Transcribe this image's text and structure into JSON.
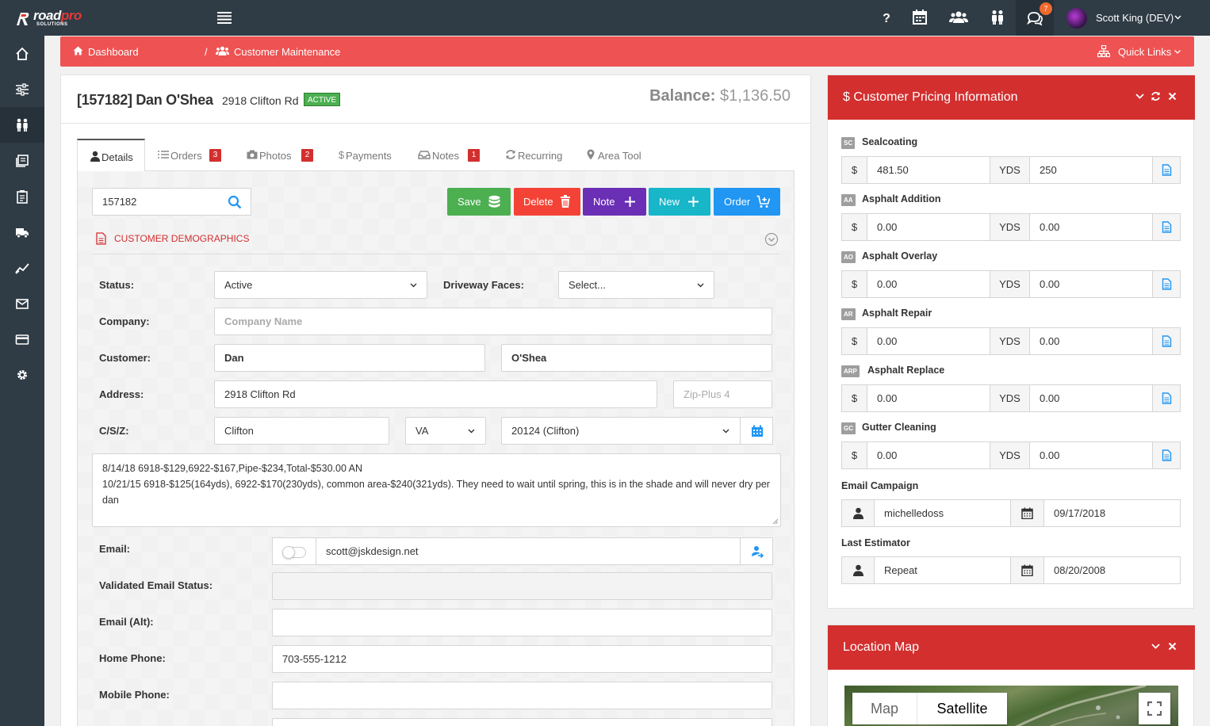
{
  "topbar": {
    "logo_word": "road",
    "logo_word_accent": "pro",
    "logo_sub": "SOLUTIONS",
    "notification_count": "7",
    "user_name": "Scott King (DEV)"
  },
  "breadcrumb": {
    "home": "Dashboard",
    "separator": "/",
    "current": "Customer Maintenance",
    "quick_links": "Quick Links"
  },
  "customer": {
    "title": "[157182] Dan O'Shea",
    "address": "2918 Clifton Rd",
    "status_badge": "ACTIVE",
    "balance_label": "Balance:",
    "balance_value": "$1,136.50"
  },
  "tabs": [
    {
      "label": "Details",
      "badge": ""
    },
    {
      "label": "Orders",
      "badge": "3"
    },
    {
      "label": "Photos",
      "badge": "2"
    },
    {
      "label": "Payments",
      "badge": ""
    },
    {
      "label": "Notes",
      "badge": "1"
    },
    {
      "label": "Recurring",
      "badge": ""
    },
    {
      "label": "Area Tool",
      "badge": ""
    }
  ],
  "search": {
    "value": "157182"
  },
  "actions": {
    "save": "Save",
    "delete": "Delete",
    "note": "Note",
    "new": "New",
    "order": "Order"
  },
  "section_title": "CUSTOMER DEMOGRAPHICS",
  "form": {
    "status_label": "Status:",
    "status_value": "Active",
    "driveway_label": "Driveway Faces:",
    "driveway_value": "Select...",
    "company_label": "Company:",
    "company_placeholder": "Company Name",
    "customer_label": "Customer:",
    "first_name": "Dan",
    "last_name": "O'Shea",
    "address_label": "Address:",
    "address_value": "2918 Clifton Rd",
    "zip_plus_placeholder": "Zip-Plus 4",
    "csz_label": "C/S/Z:",
    "city": "Clifton",
    "state": "VA",
    "zip": "20124 (Clifton)",
    "notes_line1": "8/14/18 6918-$129,6922-$167,Pipe-$234,Total-$530.00 AN",
    "notes_line2": "10/21/15 6918-$125(164yds), 6922-$170(230yds), common area-$240(321yds). They need to wait until spring, this is in the shade and will never dry per dan",
    "email_label": "Email:",
    "email_value": "scott@jskdesign.net",
    "validated_label": "Validated Email Status:",
    "validated_value": "",
    "email_alt_label": "Email (Alt):",
    "email_alt_value": "",
    "home_phone_label": "Home Phone:",
    "home_phone_value": "703-555-1212",
    "mobile_phone_label": "Mobile Phone:",
    "mobile_phone_value": ""
  },
  "pricing": {
    "title": "Customer Pricing Information",
    "currency": "$",
    "unit": "YDS",
    "services": [
      {
        "code": "SC",
        "name": "Sealcoating",
        "price": "481.50",
        "qty": "250"
      },
      {
        "code": "AA",
        "name": "Asphalt Addition",
        "price": "0.00",
        "qty": "0.00"
      },
      {
        "code": "AO",
        "name": "Asphalt Overlay",
        "price": "0.00",
        "qty": "0.00"
      },
      {
        "code": "AR",
        "name": "Asphalt Repair",
        "price": "0.00",
        "qty": "0.00"
      },
      {
        "code": "ARP",
        "name": "Asphalt Replace",
        "price": "0.00",
        "qty": "0.00"
      },
      {
        "code": "GC",
        "name": "Gutter Cleaning",
        "price": "0.00",
        "qty": "0.00"
      }
    ],
    "email_campaign_label": "Email Campaign",
    "email_campaign_user": "michelledoss",
    "email_campaign_date": "09/17/2018",
    "last_estimator_label": "Last Estimator",
    "last_estimator_user": "Repeat",
    "last_estimator_date": "08/20/2008"
  },
  "map": {
    "title": "Location Map",
    "tab_map": "Map",
    "tab_satellite": "Satellite"
  },
  "colors": {
    "sidebar": "#2f3b45",
    "accent_red": "#ee5252",
    "panel_red": "#d32f2f",
    "save_green": "#4caf50",
    "delete_red": "#f44336",
    "note_purple": "#6a2fb5",
    "new_cyan": "#17b6c9",
    "order_blue": "#2196f3"
  }
}
